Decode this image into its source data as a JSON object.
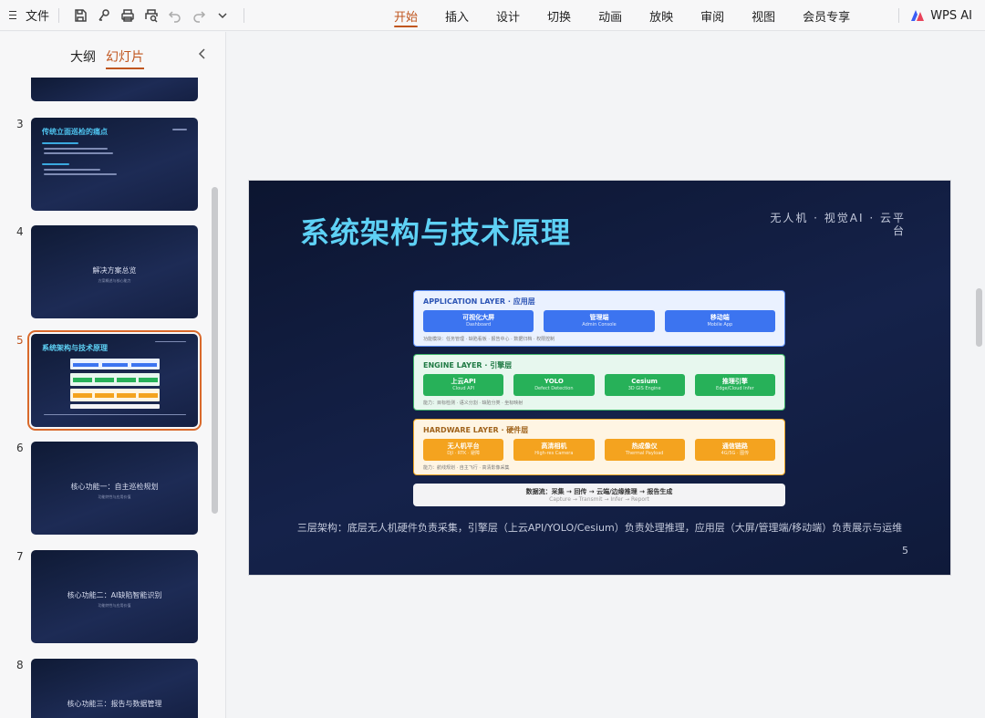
{
  "toolbar": {
    "file_label": "文件",
    "tabs": [
      {
        "label": "开始",
        "active": true
      },
      {
        "label": "插入"
      },
      {
        "label": "设计"
      },
      {
        "label": "切换"
      },
      {
        "label": "动画"
      },
      {
        "label": "放映"
      },
      {
        "label": "审阅"
      },
      {
        "label": "视图"
      },
      {
        "label": "会员专享"
      }
    ],
    "ai_label": "WPS AI",
    "accent": "#c0561f",
    "icons": [
      "save-icon",
      "share-icon",
      "print-icon",
      "print-preview-icon",
      "undo-icon",
      "redo-icon",
      "more-dropdown-icon"
    ]
  },
  "leftpanel": {
    "tab_outline": "大纲",
    "tab_slides": "幻灯片",
    "slides": [
      {
        "num": "3",
        "title": "传统立面巡检的痛点",
        "kind": "content"
      },
      {
        "num": "4",
        "title": "解决方案总览",
        "sub": "方案概述与核心能力",
        "kind": "section"
      },
      {
        "num": "5",
        "title": "系统架构与技术原理",
        "kind": "arch",
        "selected": true
      },
      {
        "num": "6",
        "title": "核心功能一：自主巡检规划",
        "sub": "功能特性与应用价值",
        "kind": "section"
      },
      {
        "num": "7",
        "title": "核心功能二：AI缺陷智能识别",
        "sub": "功能特性与应用价值",
        "kind": "section"
      },
      {
        "num": "8",
        "title": "核心功能三：报告与数据管理",
        "kind": "section"
      }
    ]
  },
  "slide": {
    "title": "系统架构与技术原理",
    "tag": "无人机 · 视觉AI · 云平台",
    "layers": {
      "app": {
        "title": "APPLICATION LAYER · 应用层",
        "boxes": [
          {
            "name": "可视化大屏",
            "en": "Dashboard"
          },
          {
            "name": "管理端",
            "en": "Admin Console"
          },
          {
            "name": "移动端",
            "en": "Mobile App"
          }
        ],
        "caption": "功能模块：任务管理 · 缺陷看板 · 报告中心 · 数据归档 · 权限控制"
      },
      "engine": {
        "title": "ENGINE LAYER · 引擎层",
        "boxes": [
          {
            "name": "上云API",
            "en": "Cloud API"
          },
          {
            "name": "YOLO",
            "en": "Defect Detection"
          },
          {
            "name": "Cesium",
            "en": "3D GIS Engine"
          },
          {
            "name": "推理引擎",
            "en": "Edge/Cloud Infer"
          }
        ],
        "caption": "能力：目标检测 · 语义分割 · 缺陷分类 · 坐标映射"
      },
      "hardware": {
        "title": "HARDWARE LAYER · 硬件层",
        "boxes": [
          {
            "name": "无人机平台",
            "en": "DJI · RTK · 避障"
          },
          {
            "name": "高清相机",
            "en": "High-res Camera"
          },
          {
            "name": "热成像仪",
            "en": "Thermal Payload"
          },
          {
            "name": "通信链路",
            "en": "4G/5G · 图传"
          }
        ],
        "caption": "能力：航线规划 · 自主飞行 · 高清影像采集"
      }
    },
    "flow": {
      "main": "数据流：采集 → 回传 → 云端/边缘推理 → 报告生成",
      "en": "Capture → Transmit → Infer → Report"
    },
    "caption": "三层架构：底层无人机硬件负责采集，引擎层（上云API/YOLO/Cesium）负责处理推理，应用层（大屏/管理端/移动端）负责展示与运维",
    "page_num": "5"
  }
}
